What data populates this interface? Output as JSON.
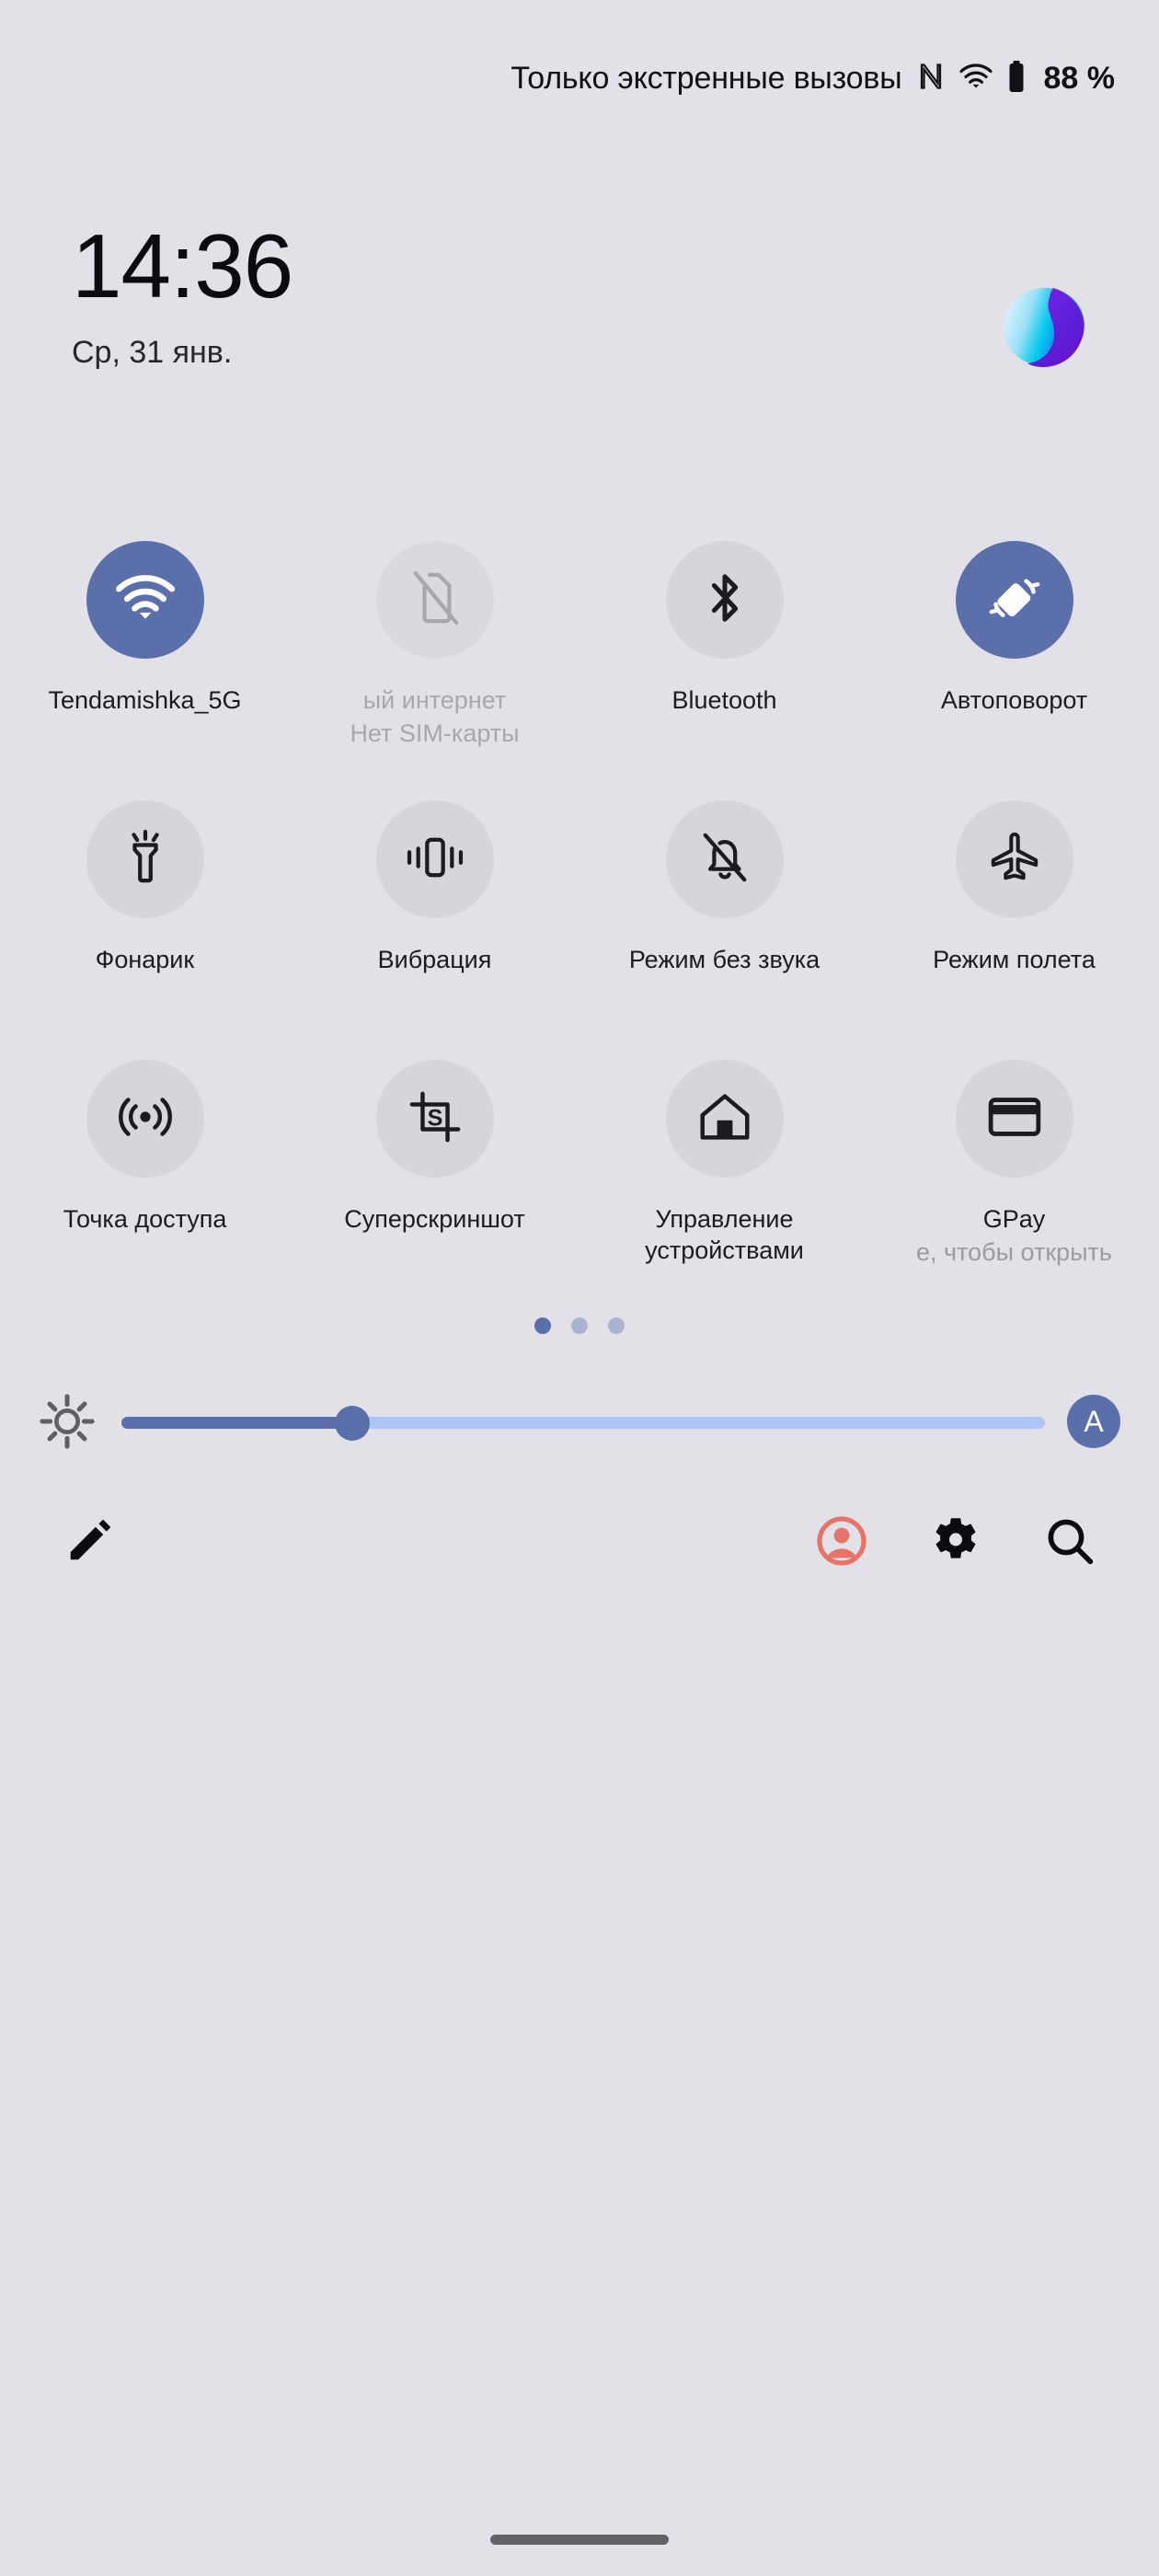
{
  "statusbar": {
    "carrier_text": "Только экстренные вызовы",
    "nfc_icon": "nfc-icon",
    "wifi_icon": "wifi-icon",
    "battery_icon": "battery-icon",
    "battery_percent": "88 %"
  },
  "header": {
    "time": "14:36",
    "date": "Ср, 31 янв.",
    "assistant_icon": "assistant-blob-icon"
  },
  "tiles": [
    {
      "id": "wifi",
      "icon": "wifi-icon",
      "label": "Tendamishka_5G",
      "sub": "",
      "state": "active"
    },
    {
      "id": "mobile-data",
      "icon": "sim-off-icon",
      "label": "ый интернет",
      "sub": "Нет SIM-карты",
      "state": "disabled"
    },
    {
      "id": "bluetooth",
      "icon": "bluetooth-icon",
      "label": "Bluetooth",
      "sub": "",
      "state": "inactive"
    },
    {
      "id": "auto-rotate",
      "icon": "auto-rotate-icon",
      "label": "Автоповорот",
      "sub": "",
      "state": "active"
    },
    {
      "id": "flashlight",
      "icon": "flashlight-icon",
      "label": "Фонарик",
      "sub": "",
      "state": "inactive"
    },
    {
      "id": "vibration",
      "icon": "vibration-icon",
      "label": "Вибрация",
      "sub": "",
      "state": "inactive"
    },
    {
      "id": "silent-mode",
      "icon": "bell-off-icon",
      "label": "Режим без звука",
      "sub": "",
      "state": "inactive"
    },
    {
      "id": "airplane-mode",
      "icon": "airplane-icon",
      "label": "Режим полета",
      "sub": "",
      "state": "inactive"
    },
    {
      "id": "hotspot",
      "icon": "hotspot-icon",
      "label": "Точка доступа",
      "sub": "",
      "state": "inactive"
    },
    {
      "id": "superscreenshot",
      "icon": "screenshot-s-icon",
      "label": "Суперскриншот",
      "sub": "",
      "state": "inactive"
    },
    {
      "id": "device-control",
      "icon": "home-icon",
      "label": "Управление устройствами",
      "sub": "",
      "state": "inactive"
    },
    {
      "id": "gpay",
      "icon": "credit-card-icon",
      "label": "GPay",
      "sub": "е, чтобы открыть",
      "state": "inactive"
    }
  ],
  "pager": {
    "count": 3,
    "active_index": 0
  },
  "brightness": {
    "sun_icon": "brightness-sun-icon",
    "value_percent": 25,
    "auto_label": "A"
  },
  "footer": {
    "edit_icon": "pencil-edit-icon",
    "user_icon": "user-account-icon",
    "settings_icon": "gear-icon",
    "search_icon": "search-icon"
  },
  "colors": {
    "background": "#E2E1E7",
    "tile_active": "#5B70AB",
    "tile_inactive": "#D6D5DB",
    "slider_fill": "#5B70AB",
    "slider_track": "#AEC4F5",
    "user_accent": "#E8736A",
    "navbar": "#636366"
  }
}
